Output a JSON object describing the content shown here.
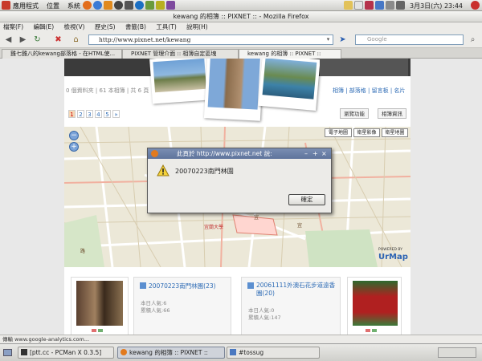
{
  "top_panel": {
    "menus": [
      "應用程式",
      "位置",
      "系統"
    ],
    "clock": "3月3日(六) 23:44"
  },
  "window": {
    "title": "kewang 的相簿 :: PIXNET :: - Mozilla Firefox"
  },
  "menu_bar": [
    "檔案(F)",
    "編輯(E)",
    "檢視(V)",
    "歷史(S)",
    "書籤(B)",
    "工具(T)",
    "說明(H)"
  ],
  "nav": {
    "url": "http://www.pixnet.net/kewang",
    "search_placeholder": "Google"
  },
  "tabs": [
    {
      "label": "雞七雞八的kewang部落格 - 在HTML使..."
    },
    {
      "label": "PIXNET 管理介面 :: 相簿自定區塊"
    },
    {
      "label": "kewang 的相簿 :: PIXNET ::"
    }
  ],
  "page": {
    "stats": "0 個資料夾 | 61 本相簿 | 共 6 頁",
    "top_links": "相簿 | 部落格 | 留言板 | 名片",
    "pages": [
      "1",
      "2",
      "3",
      "4",
      "5",
      "»"
    ],
    "right_buttons": [
      "瀏覽功能",
      "相簿資訊"
    ],
    "map_buttons": [
      "電子地圖",
      "衛星影像",
      "衛星地圖"
    ],
    "map_brand": "UrMap",
    "map_powered": "POWERED BY",
    "map_labels": [
      "宜蘭大學",
      "宜",
      "宜",
      "路"
    ]
  },
  "dialog": {
    "title": "此頁於 http://www.pixnet.net 說:",
    "message": "20070223南門林園",
    "ok_label": "確定"
  },
  "albums": [
    {
      "title": "20070223南門林園(23)",
      "today": "本日人氣:6",
      "total": "累積人氣:66"
    },
    {
      "title": "20061111外澳石花步道遠香園(20)",
      "today": "本日人氣:0",
      "total": "累積人氣:147"
    }
  ],
  "status_bar": "傳輸 www.google-analytics.com...",
  "taskbar": [
    {
      "label": "[ptt.cc - PCMan X 0.3.5]"
    },
    {
      "label": "kewang 的相簿 :: PIXNET ::"
    },
    {
      "label": "#tossug"
    }
  ],
  "colors": {
    "link": "#2d6bb5",
    "dialog_title": "#6b7fa6",
    "page_bg": "#e8e8e8"
  }
}
